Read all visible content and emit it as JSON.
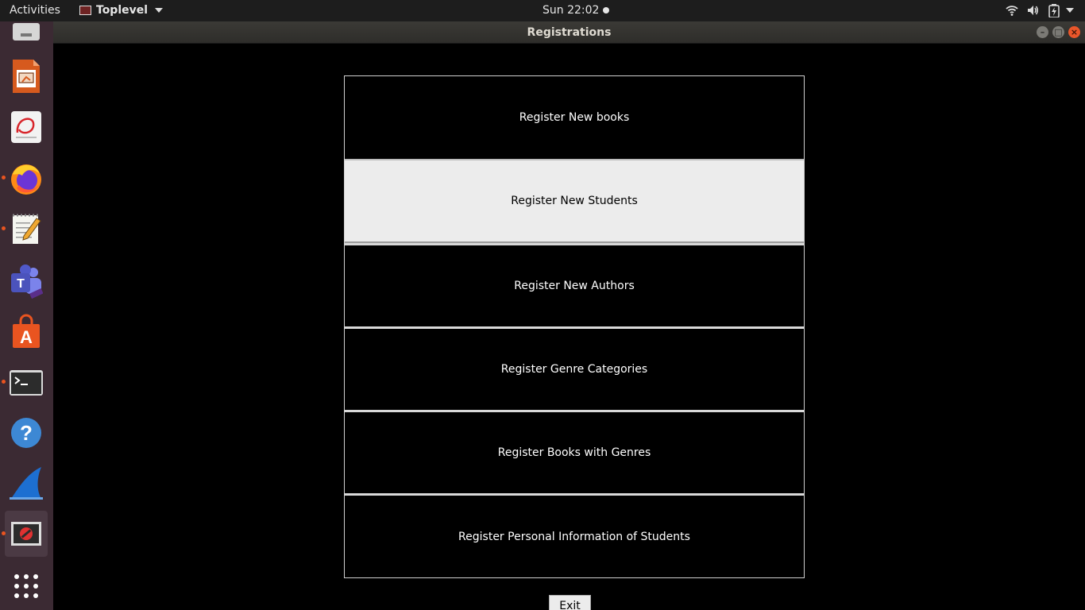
{
  "topbar": {
    "activities": "Activities",
    "app_name": "Toplevel",
    "clock": "Sun 22:02"
  },
  "window": {
    "title": "Registrations"
  },
  "dock": {
    "items": [
      {
        "icon": "removable-drive-icon"
      },
      {
        "icon": "libreoffice-impress-icon"
      },
      {
        "icon": "document-viewer-icon"
      },
      {
        "icon": "firefox-icon"
      },
      {
        "icon": "text-editor-icon"
      },
      {
        "icon": "teams-icon"
      },
      {
        "icon": "software-center-icon"
      },
      {
        "icon": "terminal-icon"
      },
      {
        "icon": "help-icon"
      },
      {
        "icon": "wireshark-icon"
      },
      {
        "icon": "tk-app-icon"
      },
      {
        "icon": "show-apps-icon"
      }
    ]
  },
  "buttons": [
    {
      "label": "Register New books"
    },
    {
      "label": "Register New Students"
    },
    {
      "label": "Register New Authors"
    },
    {
      "label": "Register Genre Categories"
    },
    {
      "label": "Register Books with Genres"
    },
    {
      "label": "Register Personal Information of Students"
    }
  ],
  "exit_label": "Exit",
  "colors": {
    "accent": "#e95420",
    "dock_bg": "#3b2a33",
    "content_bg": "#000000",
    "hover_button_bg": "#ececec"
  }
}
